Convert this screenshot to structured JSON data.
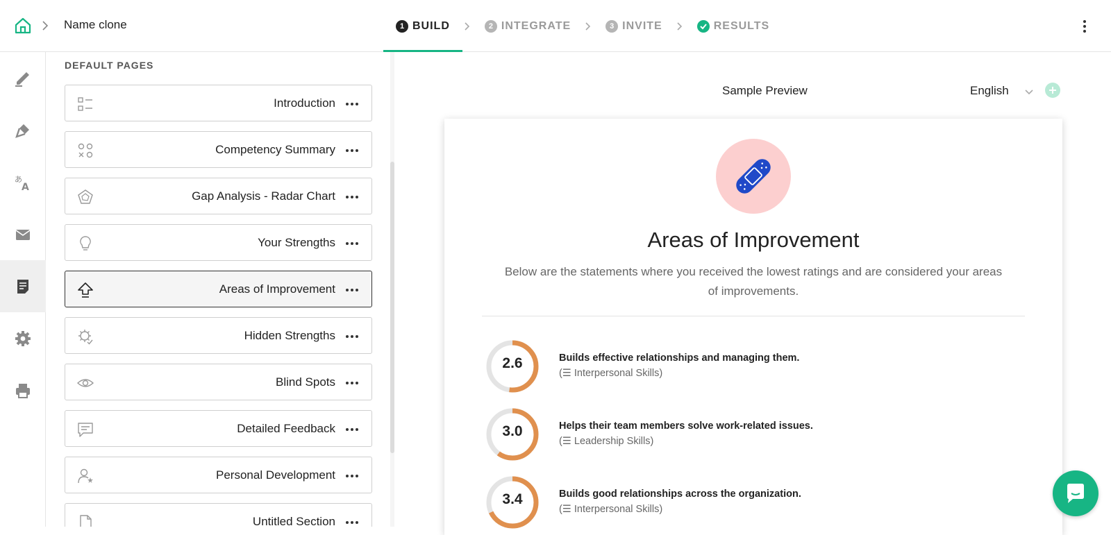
{
  "header": {
    "breadcrumb_title": "Name clone",
    "steps": [
      {
        "num": "1",
        "label": "BUILD",
        "state": "active"
      },
      {
        "num": "2",
        "label": "INTEGRATE",
        "state": "inactive"
      },
      {
        "num": "3",
        "label": "INVITE",
        "state": "inactive"
      },
      {
        "num": "",
        "label": "RESULTS",
        "state": "done"
      }
    ]
  },
  "rail": {
    "items": [
      {
        "icon": "pen-icon",
        "active": false
      },
      {
        "icon": "brush-icon",
        "active": false
      },
      {
        "icon": "translate-icon",
        "active": false
      },
      {
        "icon": "mail-icon",
        "active": false
      },
      {
        "icon": "report-icon",
        "active": true
      },
      {
        "icon": "gear-icon",
        "active": false
      },
      {
        "icon": "printer-icon",
        "active": false
      }
    ]
  },
  "panel": {
    "heading": "DEFAULT PAGES",
    "pages": [
      {
        "label": "Introduction",
        "icon": "list-icon"
      },
      {
        "label": "Competency Summary",
        "icon": "shapes-icon"
      },
      {
        "label": "Gap Analysis - Radar Chart",
        "icon": "radar-icon"
      },
      {
        "label": "Your Strengths",
        "icon": "lightbulb-icon"
      },
      {
        "label": "Areas of Improvement",
        "icon": "arrow-up-icon",
        "active": true
      },
      {
        "label": "Hidden Strengths",
        "icon": "gear-check-icon"
      },
      {
        "label": "Blind Spots",
        "icon": "eye-icon"
      },
      {
        "label": "Detailed Feedback",
        "icon": "message-icon"
      },
      {
        "label": "Personal Development",
        "icon": "user-star-icon"
      },
      {
        "label": "Untitled Section",
        "icon": "file-icon"
      }
    ]
  },
  "preview": {
    "label": "Sample Preview",
    "language": "English",
    "title": "Areas of Improvement",
    "description": "Below are the statements where you received the lowest ratings and are considered your areas of improvements.",
    "statements": [
      {
        "score": "2.6",
        "fraction": 0.52,
        "text": "Builds effective relationships and managing them.",
        "category": "Interpersonal Skills"
      },
      {
        "score": "3.0",
        "fraction": 0.6,
        "text": "Helps their team members solve work-related issues.",
        "category": "Leadership Skills"
      },
      {
        "score": "3.4",
        "fraction": 0.68,
        "text": "Builds good relationships across the organization.",
        "category": "Interpersonal Skills"
      }
    ]
  },
  "colors": {
    "accent": "#17b584",
    "ring_fill": "#e0904e",
    "ring_track": "#e4e4e4",
    "badge_bg": "#fccfcf",
    "badge_icon": "#1f49c8"
  }
}
